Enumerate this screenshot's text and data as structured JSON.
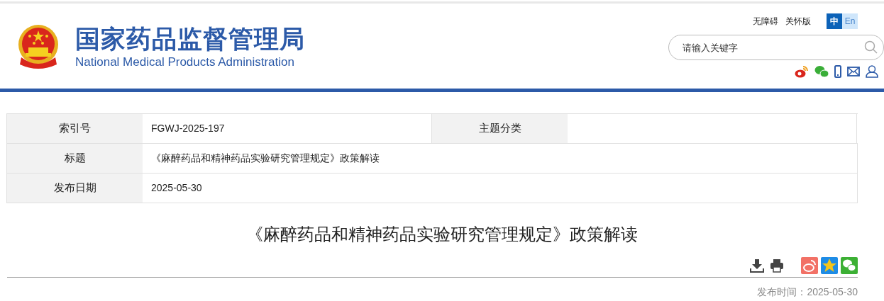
{
  "header": {
    "title": "国家药品监督管理局",
    "subtitle": "National Medical Products Administration",
    "links": [
      "无障碍",
      "关怀版"
    ],
    "languages": [
      {
        "label": "中",
        "selected": true
      },
      {
        "label": "En",
        "selected": false
      }
    ],
    "search": {
      "placeholder": "请输入关键字"
    }
  },
  "meta_table": {
    "rows": [
      [
        {
          "label": "索引号",
          "value": "FGWJ-2025-197"
        },
        {
          "label": "主题分类"
        }
      ],
      [
        {
          "label": "标题",
          "value": "《麻醉药品和精神药品实验研究管理规定》政策解读"
        }
      ],
      [
        {
          "label": "发布日期",
          "value": "2025-05-30"
        }
      ]
    ]
  },
  "article": {
    "title": "《麻醉药品和精神药品实验研究管理规定》政策解读",
    "publish_time": "发布时间：2025-05-30"
  }
}
